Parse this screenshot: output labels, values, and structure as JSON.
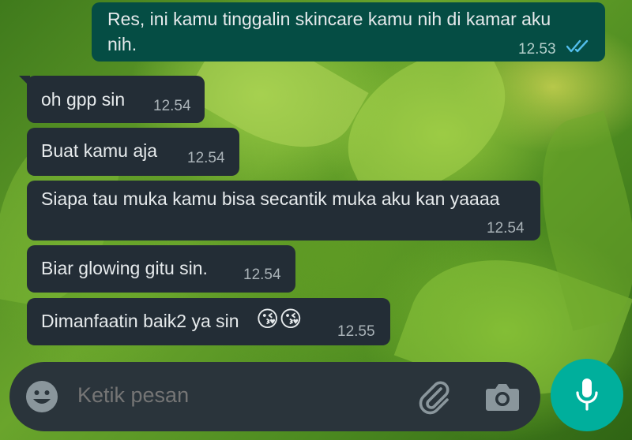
{
  "messages": [
    {
      "direction": "outgoing",
      "line1": "Res, ini kamu tinggalin skincare kamu nih di kamar aku",
      "line2": "nih.",
      "time": "12.53",
      "status": "read"
    },
    {
      "direction": "incoming",
      "text": "oh gpp sin",
      "time": "12.54"
    },
    {
      "direction": "incoming",
      "text": "Buat kamu aja",
      "time": "12.54"
    },
    {
      "direction": "incoming",
      "text": "Siapa tau muka kamu bisa secantik muka aku kan yaaaa",
      "time": "12.54"
    },
    {
      "direction": "incoming",
      "text": "Biar glowing gitu sin.",
      "time": "12.54"
    },
    {
      "direction": "incoming",
      "text": "Dimanfaatin baik2 ya sin",
      "emoji": "😘😘",
      "time": "12.55"
    }
  ],
  "composer": {
    "placeholder": "Ketik pesan",
    "icons": [
      "emoji-icon",
      "paperclip-icon",
      "camera-icon",
      "microphone-icon"
    ]
  },
  "colors": {
    "incoming_bubble": "#232d36",
    "outgoing_bubble": "#054d44",
    "read_ticks": "#53bdeb",
    "mic_button": "#00af9c"
  }
}
